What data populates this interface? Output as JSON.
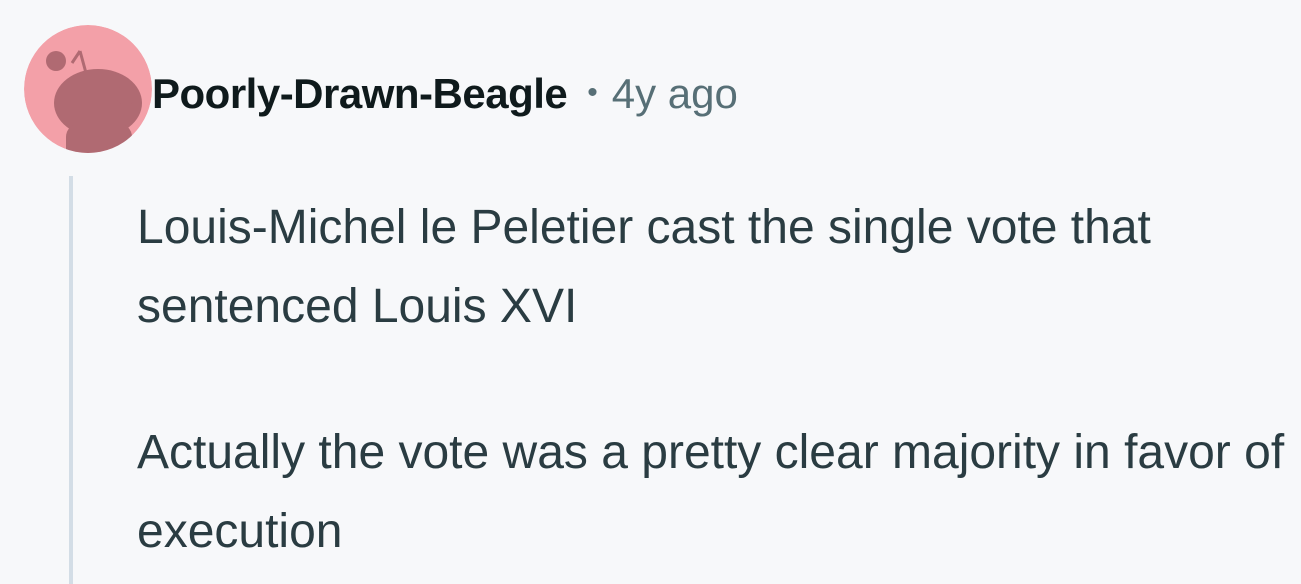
{
  "comment": {
    "author": "Poorly-Drawn-Beagle",
    "separator": "•",
    "time_ago": "4y ago",
    "avatar_icon": "reddit-snoo-avatar-icon",
    "avatar_bg": "#f3a0a8",
    "avatar_fg": "#b06a72",
    "paragraphs": [
      "Louis-Michel le Peletier cast the single vote that sentenced Louis XVI",
      "Actually the vote was a pretty clear majority in favor of execution"
    ]
  }
}
